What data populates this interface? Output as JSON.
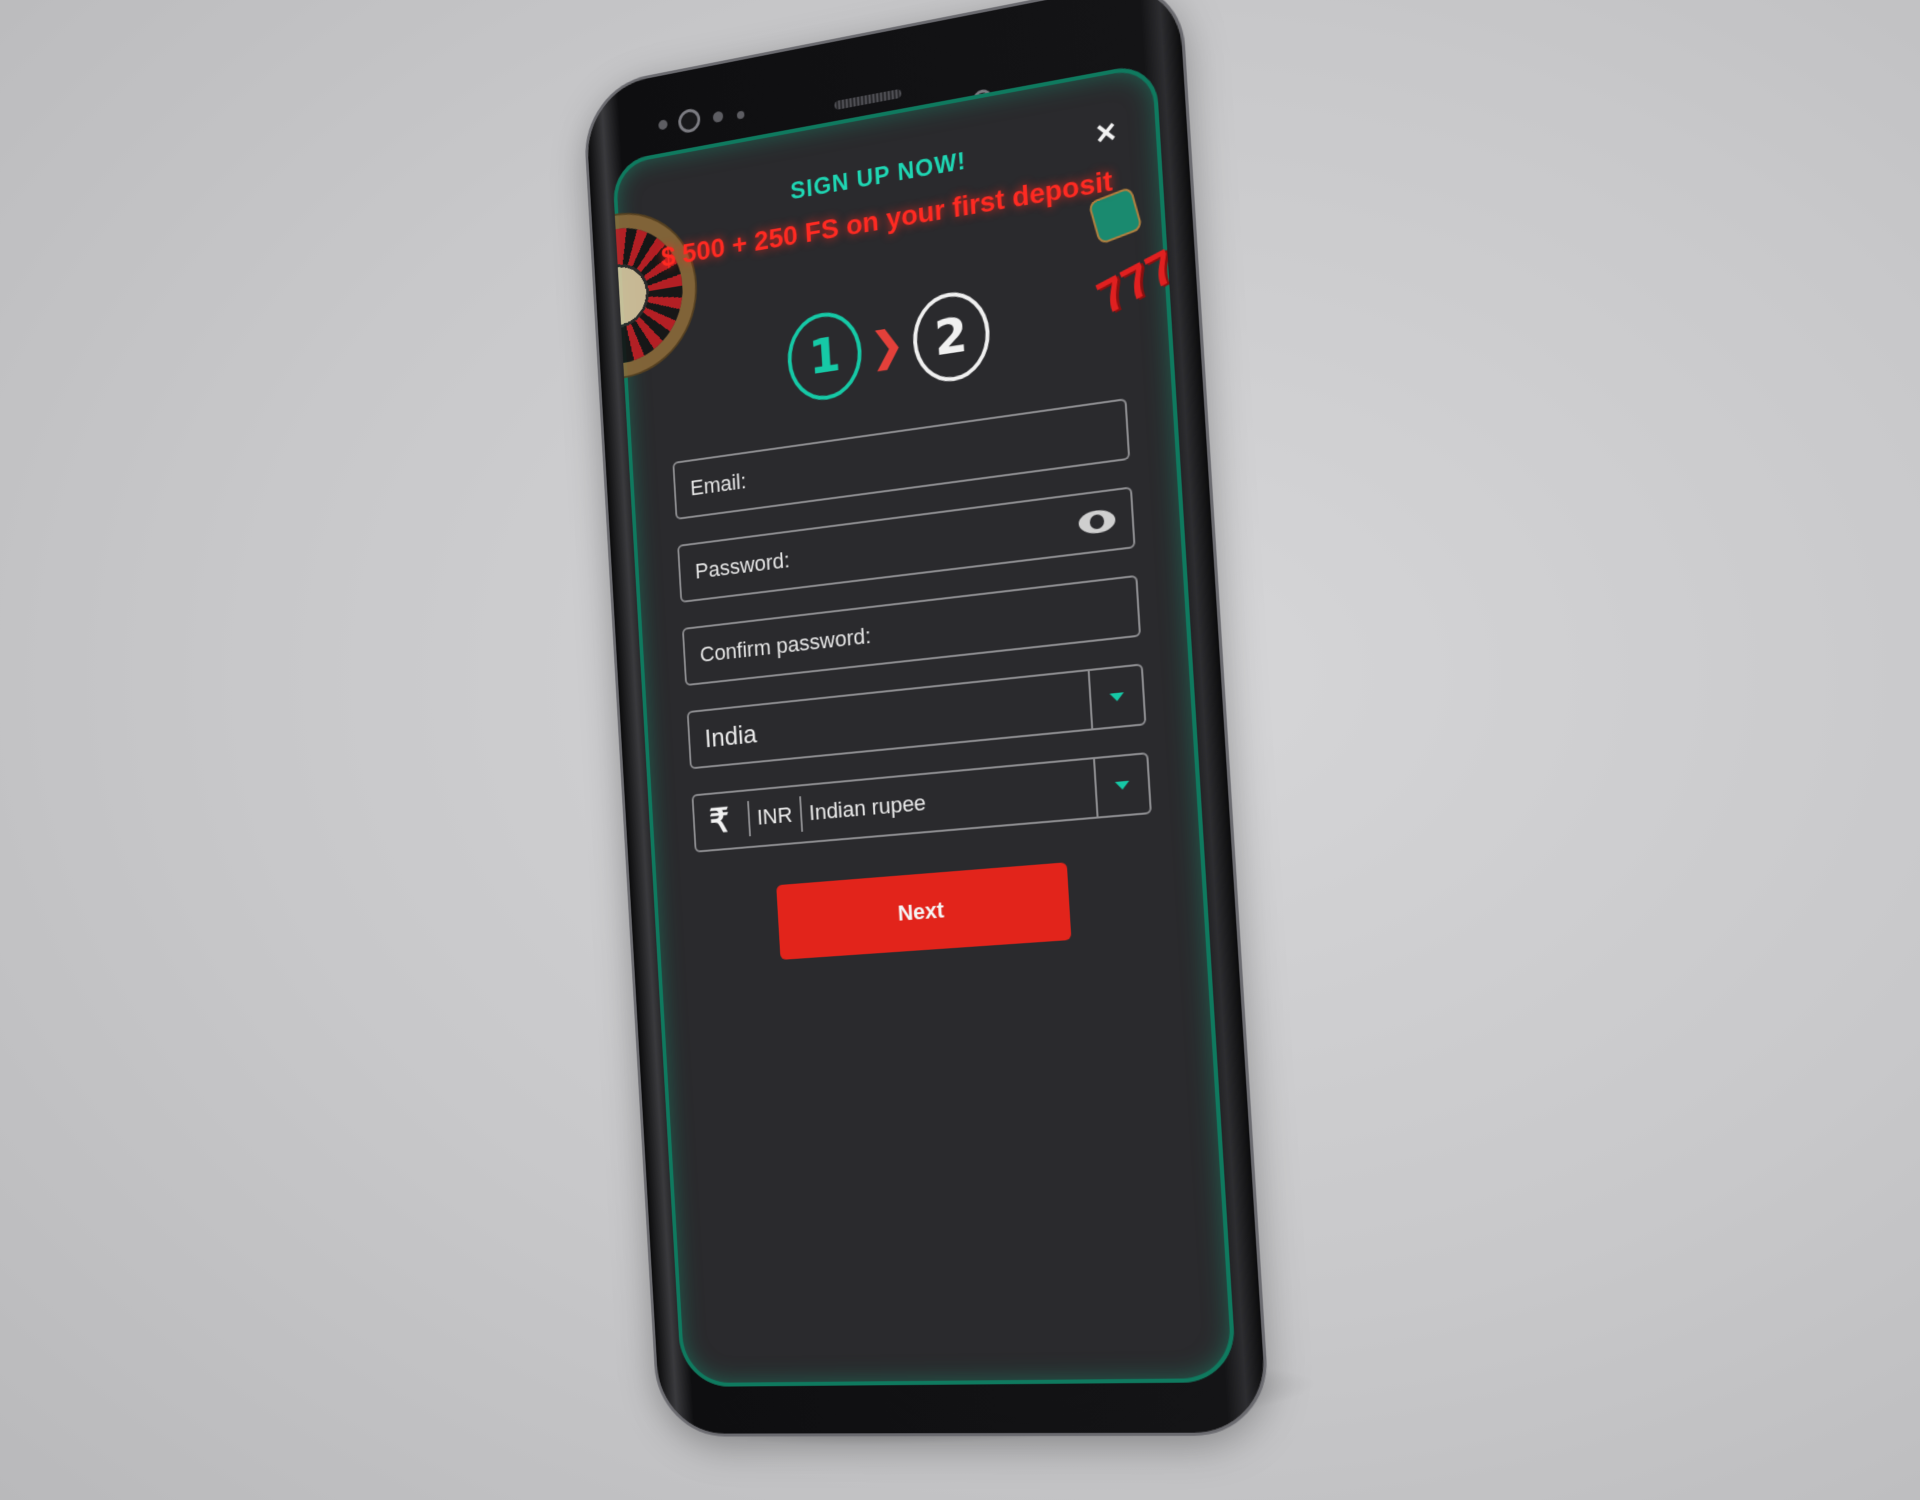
{
  "popup": {
    "headline": "SIGN UP NOW!",
    "offer": "$ 500 + 250 FS on your first deposit",
    "close_icon": "×"
  },
  "steps": {
    "items": [
      {
        "label": "1",
        "state": "active"
      },
      {
        "label": "2",
        "state": "inactive"
      }
    ],
    "separator": "❯"
  },
  "form": {
    "email": {
      "placeholder": "Email:",
      "value": ""
    },
    "password": {
      "placeholder": "Password:",
      "value": ""
    },
    "confirm_password": {
      "placeholder": "Confirm password:",
      "value": ""
    },
    "country": {
      "selected": "India"
    },
    "currency": {
      "symbol": "₹",
      "code": "INR",
      "name": "Indian rupee"
    },
    "submit_label": "Next"
  },
  "decor": {
    "sevens": "777"
  },
  "colors": {
    "accent_teal": "#16c9a6",
    "accent_red": "#e2241b",
    "background": "#2a2a2d"
  }
}
